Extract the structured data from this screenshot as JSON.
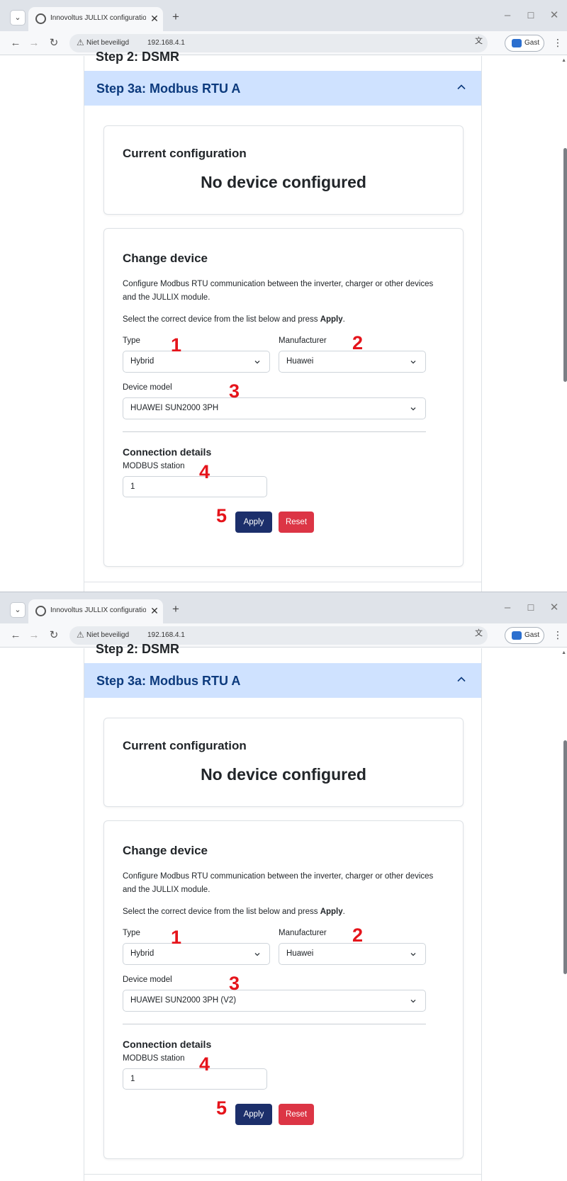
{
  "browser": {
    "tab_title": "Innovoltus JULLIX configuration",
    "tab_close": "✕",
    "new_tab": "+",
    "security_label": "Niet beveiligd",
    "url": "192.168.4.1",
    "profile_label": "Gast"
  },
  "page": {
    "previous_step_title": "Step 2: DSMR",
    "accordion_title": "Step 3a: Modbus RTU A",
    "current_card": {
      "title": "Current configuration",
      "value": "No device configured"
    },
    "change_card": {
      "title": "Change device",
      "description": "Configure Modbus RTU communication between the inverter, charger or other devices and the JULLIX module.",
      "instruction_prefix": "Select the correct device from the list below and press ",
      "instruction_bold": "Apply",
      "instruction_suffix": ".",
      "type_label": "Type",
      "manufacturer_label": "Manufacturer",
      "model_label": "Device model",
      "connection_title": "Connection details",
      "station_label": "MODBUS station",
      "apply_label": "Apply",
      "reset_label": "Reset"
    }
  },
  "screens": [
    {
      "type_value": "Hybrid",
      "manufacturer_value": "Huawei",
      "model_value": "HUAWEI SUN2000 3PH",
      "station_value": "1"
    },
    {
      "type_value": "Hybrid",
      "manufacturer_value": "Huawei",
      "model_value": "HUAWEI SUN2000 3PH (V2)",
      "station_value": "1"
    }
  ],
  "markers": [
    "1",
    "2",
    "3",
    "4",
    "5"
  ],
  "colors": {
    "accordion_header_bg": "#cfe2ff",
    "accordion_title": "#0c3a7d",
    "apply_button": "#1c2f6b",
    "reset_button": "#dc3545",
    "marker": "#e5141b"
  }
}
